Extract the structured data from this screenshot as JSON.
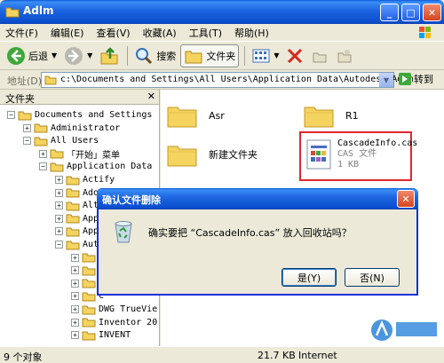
{
  "window": {
    "title": "Adlm"
  },
  "menu": [
    "文件(F)",
    "编辑(E)",
    "查看(V)",
    "收藏(A)",
    "工具(T)",
    "帮助(H)"
  ],
  "toolbar": {
    "back": "后退",
    "search": "搜索",
    "folders": "文件夹"
  },
  "address": {
    "label": "地址(D)",
    "path": "c:\\Documents and Settings\\All Users\\Application Data\\Autodesk\\Adlm",
    "go": "转到"
  },
  "folderpane": {
    "title": "文件夹",
    "tree": [
      {
        "label": "Documents and Settings",
        "pm": "−"
      },
      {
        "label": "Administrator",
        "pm": "+"
      },
      {
        "label": "All Users",
        "pm": "−"
      },
      {
        "label": "「开始」菜单",
        "pm": "+"
      },
      {
        "label": "Application Data",
        "pm": "−"
      },
      {
        "label": "Actify",
        "pm": "+"
      },
      {
        "label": "Adobe",
        "pm": "+"
      },
      {
        "label": "Altiv",
        "pm": "+"
      },
      {
        "label": "Apple",
        "pm": "+"
      },
      {
        "label": "Apple",
        "pm": "+"
      },
      {
        "label": "Autod",
        "pm": "−"
      },
      {
        "label": "A",
        "pm": "+"
      },
      {
        "label": "A",
        "pm": "+"
      },
      {
        "label": "A",
        "pm": "+"
      },
      {
        "label": "C",
        "pm": "+"
      },
      {
        "label": "DWG TrueVie",
        "pm": "+"
      },
      {
        "label": "Inventor 20",
        "pm": "+"
      },
      {
        "label": "INVENT",
        "pm": "+"
      }
    ]
  },
  "content": {
    "items": [
      {
        "name": "Asr"
      },
      {
        "name": "R1"
      },
      {
        "name": "新建文件夹"
      }
    ],
    "cas": {
      "name": "CascadeInfo.cas",
      "type": "CAS 文件",
      "size": "1 KB"
    }
  },
  "status": {
    "objects": "9 个对象",
    "size": "21.7 KB",
    "zone": "Internet"
  },
  "dialog": {
    "title": "确认文件删除",
    "message": "确实要把 “CascadeInfo.cas” 放入回收站吗？",
    "yes": "是(Y)",
    "no": "否(N)"
  },
  "colors": {
    "titlebar": "#0a5bd8",
    "highlight": "#e0272c",
    "folder": "#f4d35e"
  }
}
